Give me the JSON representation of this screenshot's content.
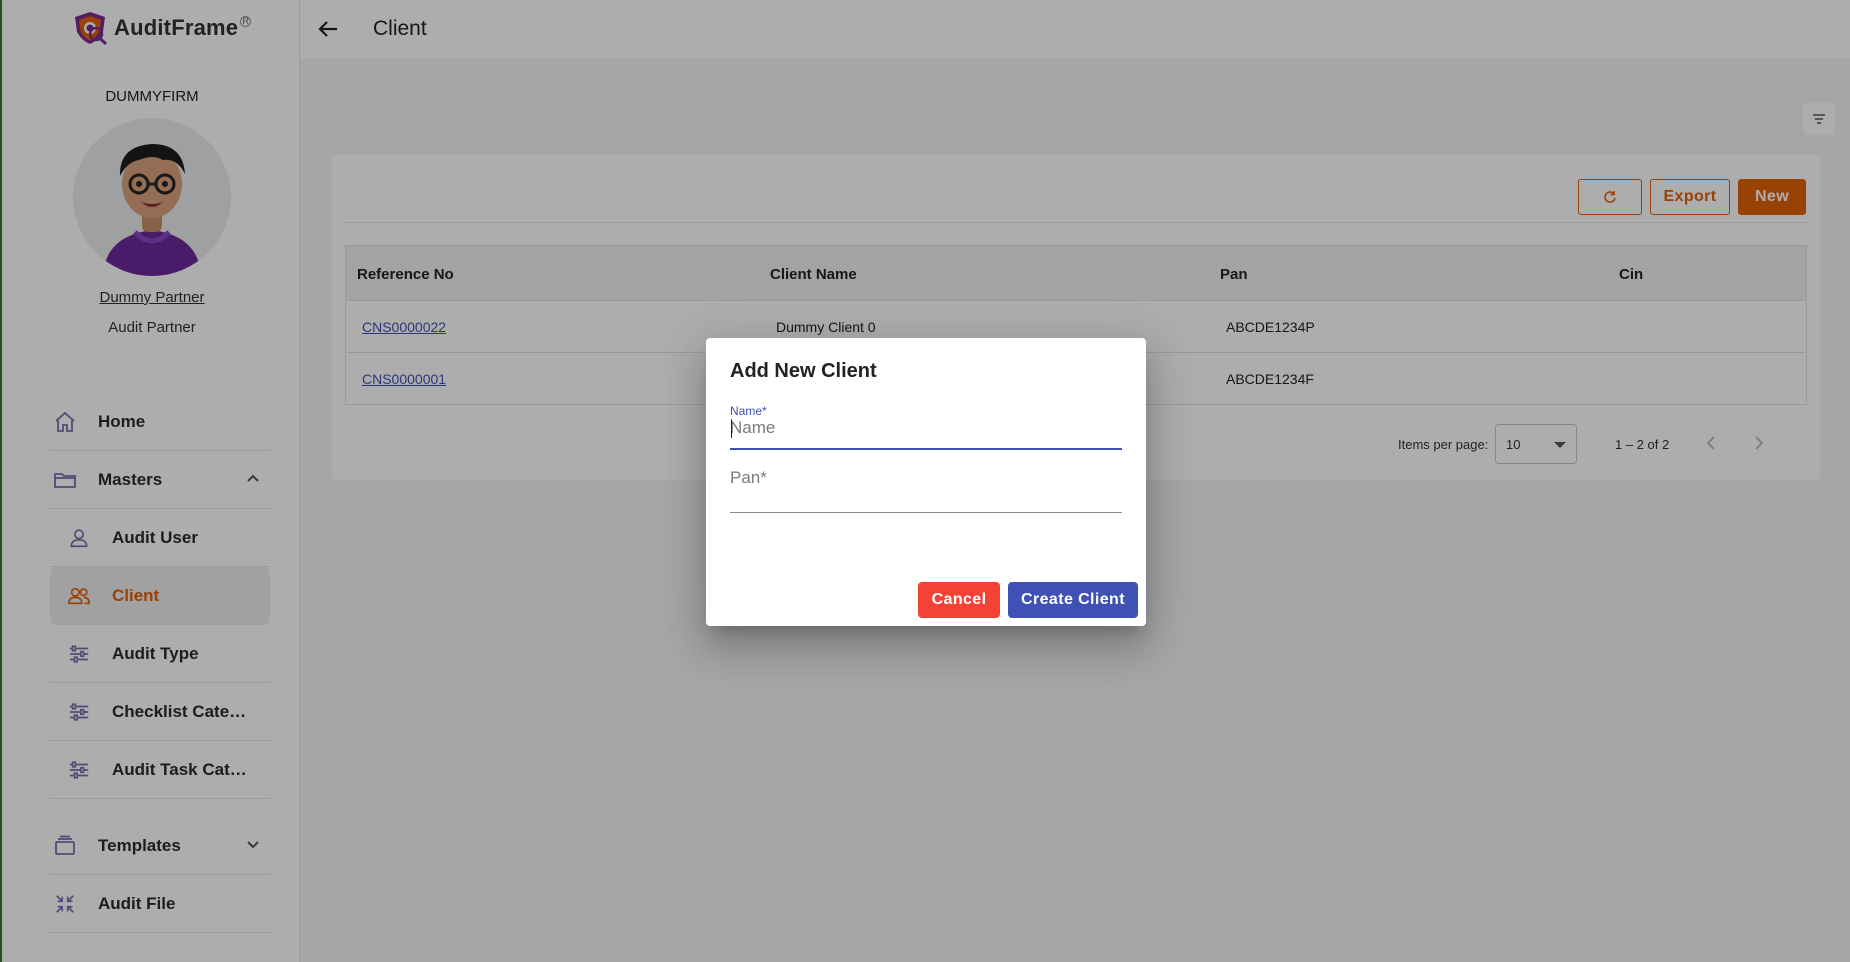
{
  "app": {
    "name": "AuditFrame",
    "reg_mark": "R"
  },
  "sidebar": {
    "firm": "DUMMYFIRM",
    "user_name": "Dummy Partner",
    "user_role": "Audit Partner",
    "items": [
      {
        "label": "Home",
        "icon": "home-icon"
      },
      {
        "label": "Masters",
        "icon": "folder-icon",
        "expanded": true
      },
      {
        "label": "Audit User",
        "icon": "user-icon"
      },
      {
        "label": "Client",
        "icon": "users-icon",
        "active": true
      },
      {
        "label": "Audit Type",
        "icon": "sliders-icon"
      },
      {
        "label": "Checklist Cate…",
        "icon": "sliders-icon"
      },
      {
        "label": "Audit Task Cat…",
        "icon": "sliders-icon"
      },
      {
        "label": "Templates",
        "icon": "stack-icon",
        "expanded": false
      },
      {
        "label": "Audit File",
        "icon": "compress-icon"
      }
    ]
  },
  "header": {
    "title": "Client"
  },
  "toolbar": {
    "export_label": "Export",
    "new_label": "New"
  },
  "table": {
    "columns": [
      "Reference No",
      "Client Name",
      "Pan",
      "Cin"
    ],
    "rows": [
      {
        "ref": "CNS0000022",
        "name": "Dummy Client 0",
        "pan": "ABCDE1234P",
        "cin": ""
      },
      {
        "ref": "CNS0000001",
        "name": "",
        "pan": "ABCDE1234F",
        "cin": ""
      }
    ]
  },
  "pager": {
    "items_label": "Items per page:",
    "page_size": "10",
    "range": "1 – 2 of 2"
  },
  "dialog": {
    "title": "Add New Client",
    "name_label": "Name*",
    "name_placeholder": "Name",
    "name_value": "",
    "pan_placeholder": "Pan*",
    "pan_value": "",
    "cancel_label": "Cancel",
    "create_label": "Create Client"
  },
  "colors": {
    "accent": "#e2620a",
    "primary": "#3f51b5",
    "danger": "#f44336"
  }
}
